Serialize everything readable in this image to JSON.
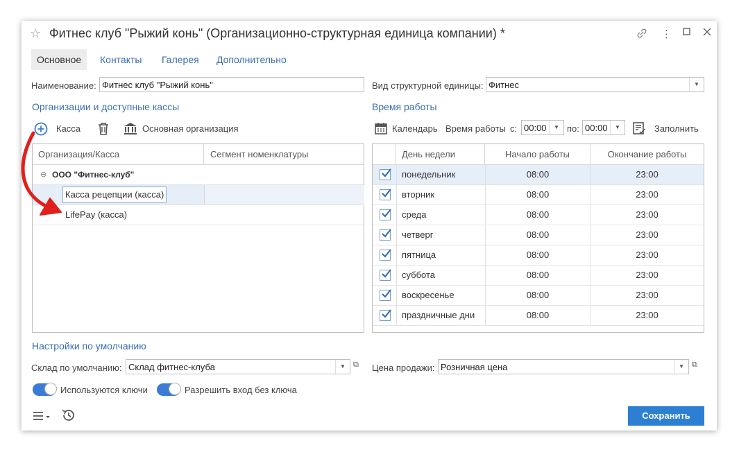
{
  "window": {
    "title": "Фитнес клуб \"Рыжий конь\" (Организационно-структурная единица компании) *"
  },
  "tabs": [
    "Основное",
    "Контакты",
    "Галерея",
    "Дополнительно"
  ],
  "name_field": {
    "label": "Наименование:",
    "value": "Фитнес клуб \"Рыжий конь\""
  },
  "unit_type": {
    "label": "Вид структурной единицы:",
    "value": "Фитнес"
  },
  "org_section": {
    "title": "Организации и доступные кассы",
    "add_label": "Касса",
    "main_org_label": "Основная организация",
    "columns": [
      "Организация/Касса",
      "Сегмент номенклатуры"
    ],
    "group": "ООО \"Фитнес-клуб\"",
    "items": [
      "Касса рецепции (касса)",
      "LifePay (касса)"
    ]
  },
  "schedule": {
    "title": "Время работы",
    "calendar_label": "Календарь",
    "time_label": "Время работы",
    "from_label": "с:",
    "from_value": "00:00",
    "to_label": "по:",
    "to_value": "00:00",
    "fill_label": "Заполнить",
    "columns": [
      "День недели",
      "Начало работы",
      "Окончание работы"
    ],
    "rows": [
      {
        "day": "понедельник",
        "start": "08:00",
        "end": "23:00"
      },
      {
        "day": "вторник",
        "start": "08:00",
        "end": "23:00"
      },
      {
        "day": "среда",
        "start": "08:00",
        "end": "23:00"
      },
      {
        "day": "четверг",
        "start": "08:00",
        "end": "23:00"
      },
      {
        "day": "пятница",
        "start": "08:00",
        "end": "23:00"
      },
      {
        "day": "суббота",
        "start": "08:00",
        "end": "23:00"
      },
      {
        "day": "воскресенье",
        "start": "08:00",
        "end": "23:00"
      },
      {
        "day": "праздничные дни",
        "start": "08:00",
        "end": "23:00"
      }
    ]
  },
  "defaults": {
    "title": "Настройки по умолчанию",
    "warehouse_label": "Склад по умолчанию:",
    "warehouse_value": "Склад фитнес-клуба",
    "price_label": "Цена продажи:",
    "price_value": "Розничная цена",
    "toggle_keys": "Используются ключи",
    "toggle_no_key": "Разрешить вход без ключа"
  },
  "save_label": "Сохранить",
  "colors": {
    "accent": "#3a6fb0",
    "primary_button": "#2d7fd3",
    "annotation_arrow": "#e0201b"
  }
}
